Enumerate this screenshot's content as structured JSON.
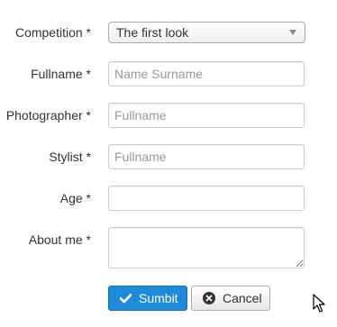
{
  "form": {
    "competition": {
      "label": "Competition *",
      "selected": "The first look"
    },
    "fullname": {
      "label": "Fullname *",
      "placeholder": "Name Surname",
      "value": ""
    },
    "photographer": {
      "label": "Photographer *",
      "placeholder": "Fullname",
      "value": ""
    },
    "stylist": {
      "label": "Stylist *",
      "placeholder": "Fullname",
      "value": ""
    },
    "age": {
      "label": "Age *",
      "placeholder": "",
      "value": ""
    },
    "about_me": {
      "label": "About me *",
      "value": ""
    }
  },
  "buttons": {
    "submit_label": "Sumbit",
    "cancel_label": "Cancel"
  },
  "icons": {
    "submit": "check-icon",
    "cancel": "close-circle-icon",
    "cursor": "mouse-pointer-icon",
    "dropdown": "caret-down-icon"
  },
  "colors": {
    "primary": "#1e8ad8",
    "primary_border": "#146fb3",
    "text": "#333333",
    "placeholder": "#999999",
    "border": "#cccccc"
  }
}
